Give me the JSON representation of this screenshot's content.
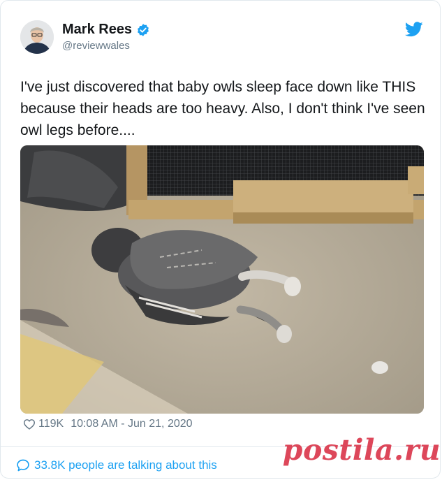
{
  "tweet": {
    "author": {
      "display_name": "Mark Rees",
      "handle": "@reviewwales",
      "verified": true
    },
    "text": "I've just discovered that baby owls sleep face down like THIS because their heads are too heavy. Also, I don't think I've seen owl legs before....",
    "likes": "119K",
    "timestamp": "10:08 AM - Jun 21, 2020",
    "talking": "33.8K people are talking about this"
  },
  "icons": {
    "verified": "verified-badge-icon",
    "bird": "twitter-bird-icon",
    "heart": "heart-icon",
    "bubble": "speech-bubble-icon"
  },
  "colors": {
    "twitter_blue": "#1da1f2",
    "secondary_text": "#657786",
    "watermark": "#d61e36"
  },
  "watermark": "postila.ru"
}
